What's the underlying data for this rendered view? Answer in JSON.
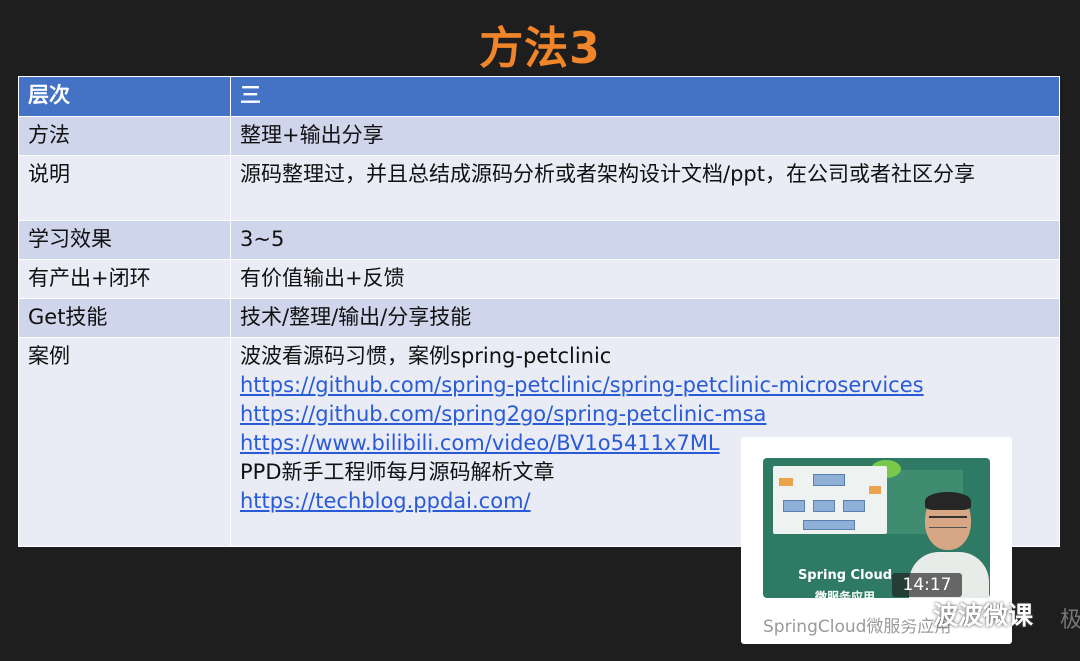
{
  "slide": {
    "title": "方法3"
  },
  "table": {
    "header": {
      "col1": "层次",
      "col2": "三"
    },
    "rows": [
      {
        "label": "方法",
        "value": "整理+输出分享"
      },
      {
        "label": "说明",
        "value": "源码整理过，并且总结成源码分析或者架构设计文档/ppt，在公司或者社区分享"
      },
      {
        "label": "学习效果",
        "value": "3~5"
      },
      {
        "label": "有产出+闭环",
        "value": "有价值输出+反馈"
      },
      {
        "label": "Get技能",
        "value": "技术/整理/输出/分享技能"
      }
    ],
    "case": {
      "label": "案例",
      "lines": [
        {
          "text": "波波看源码习惯，案例spring-petclinic"
        },
        {
          "link": "https://github.com/spring-petclinic/spring-petclinic-microservices"
        },
        {
          "link": "https://github.com/spring2go/spring-petclinic-msa"
        },
        {
          "link": "https://www.bilibili.com/video/BV1o5411x7ML"
        },
        {
          "text": "PPD新手工程师每月源码解析文章"
        },
        {
          "link": "https://techblog.ppdai.com/"
        }
      ]
    }
  },
  "video_card": {
    "thumbnail_caption_line1": "Spring Cloud",
    "thumbnail_caption_line2": "微服务应用",
    "duration": "14:17",
    "title": "SpringCloud微服务应用"
  },
  "watermark": {
    "icon": "wechat-icon",
    "text": "波波微课",
    "edge_char": "极"
  },
  "colors": {
    "title": "#f0852a",
    "header_bg": "#4472c4",
    "row_odd": "#cfd5ea",
    "row_even": "#e9ebf5",
    "link": "#2a5bd7",
    "background": "#1e1e1e"
  }
}
